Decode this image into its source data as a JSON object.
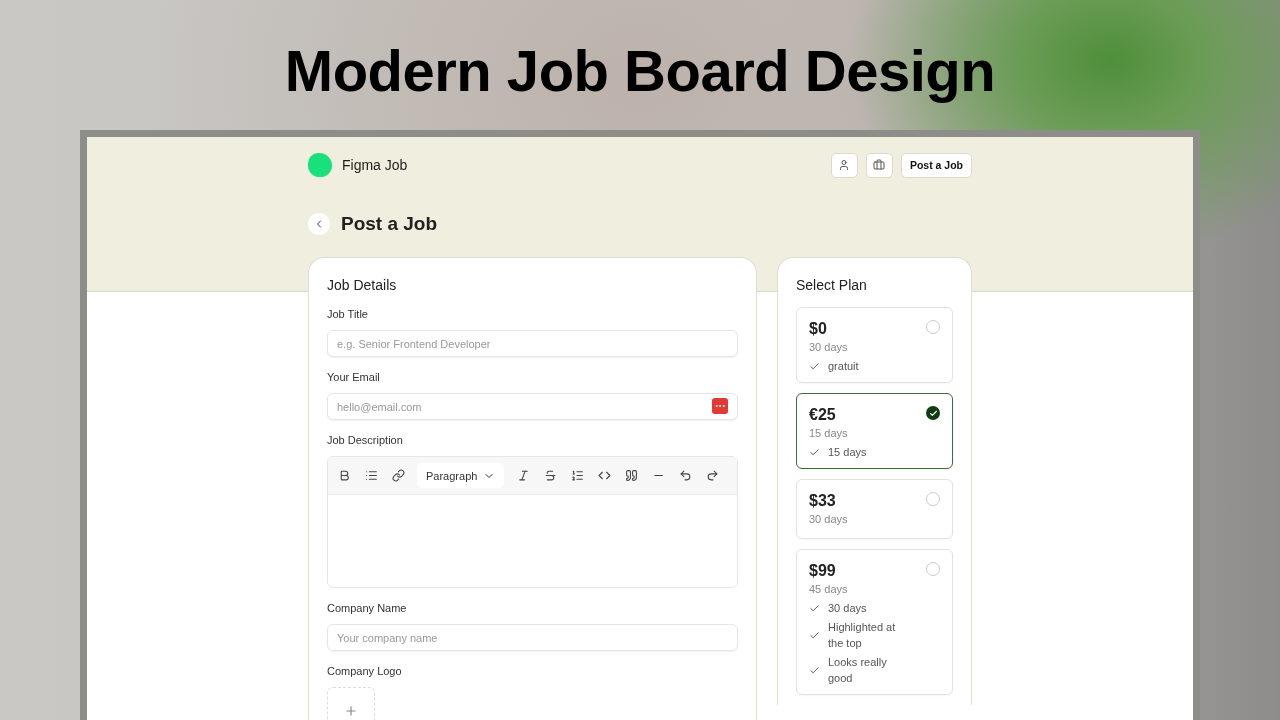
{
  "headline": "Modern Job Board Design",
  "app": {
    "brand": "Figma Job",
    "nav_icons": [
      {
        "kind": "user"
      },
      {
        "kind": "briefcase"
      }
    ],
    "nav_button": "Post a Job"
  },
  "page_title": "Post a Job",
  "job_details": {
    "title": "Job Details",
    "fields": [
      {
        "kind": "input",
        "label": "Job Title",
        "placeholder": "e.g. Senior Frontend Developer",
        "badge": false
      },
      {
        "kind": "input",
        "label": "Your Email",
        "placeholder": "hello@email.com",
        "badge": true
      },
      {
        "kind": "editor",
        "label": "Job Description",
        "block_style": "Paragraph"
      },
      {
        "kind": "input",
        "label": "Company Name",
        "placeholder": "Your company name",
        "badge": false
      },
      {
        "kind": "logo",
        "label": "Company Logo"
      }
    ]
  },
  "plans": {
    "title": "Select Plan",
    "items": [
      {
        "price": "$0",
        "duration": "30 days",
        "features": [
          "gratuit"
        ],
        "selected": false
      },
      {
        "price": "€25",
        "duration": "15 days",
        "features": [
          "15 days"
        ],
        "selected": true
      },
      {
        "price": "$33",
        "duration": "30 days",
        "selected": false
      },
      {
        "price": "$99",
        "duration": "45 days",
        "features": [
          "30 days",
          "Highlighted at the top",
          "Looks really good"
        ],
        "selected": false
      }
    ]
  }
}
